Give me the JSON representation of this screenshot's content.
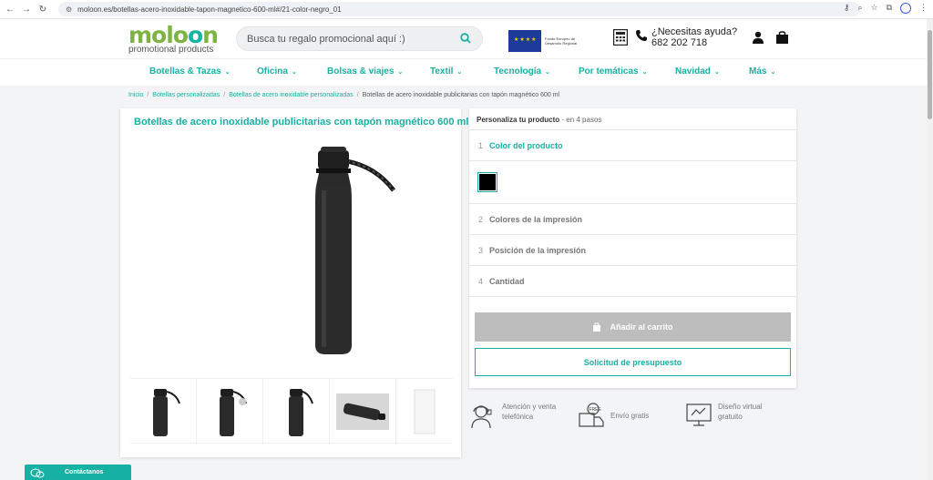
{
  "browser": {
    "url": "moloon.es/botellas-acero-inoxidable-tapon-magnetico-600-ml#/21-color-negro_01"
  },
  "header": {
    "logo_part1": "molo",
    "logo_oo": "o",
    "logo_part2": "n",
    "logo_tagline": "promotional products",
    "search_placeholder": "Busca tu regalo promocional aquí :)",
    "help_line1": "¿Necesitas ayuda?",
    "help_phone": "682 202 718"
  },
  "menu": {
    "items": [
      {
        "label": "Botellas & Tazas"
      },
      {
        "label": "Oficina"
      },
      {
        "label": "Bolsas & viajes"
      },
      {
        "label": "Textil"
      },
      {
        "label": "Tecnología"
      },
      {
        "label": "Por temáticas"
      },
      {
        "label": "Navidad"
      },
      {
        "label": "Más"
      }
    ]
  },
  "breadcrumb": {
    "items": [
      "Inicio",
      "Botellas personalizadas",
      "Botellas de acero inoxidable personalizadas",
      "Botellas de acero inoxidable publicitarias con tapón magnético 600 ml"
    ]
  },
  "product": {
    "title": "Botellas de acero inoxidable publicitarias con tapón magnético 600 ml"
  },
  "customizer": {
    "head_bold": "Personaliza tu producto",
    "head_sub": "- en 4 pasos",
    "steps": [
      {
        "num": "1",
        "label": "Color del producto"
      },
      {
        "num": "2",
        "label": "Colores de la impresión"
      },
      {
        "num": "3",
        "label": "Posición de la impresión"
      },
      {
        "num": "4",
        "label": "Cantidad"
      }
    ],
    "selected_color": "#000000",
    "add_to_cart": "Añadir al carrito",
    "quote": "Solicitud de presupuesto"
  },
  "features": [
    {
      "text": "Atención y venta telefónica",
      "icon": "support-agent-icon"
    },
    {
      "text": "Envío gratis",
      "icon": "free-shipping-icon"
    },
    {
      "text": "Diseño virtual gratuito",
      "icon": "virtual-design-icon"
    }
  ],
  "contact": {
    "label": "Contáctanos"
  },
  "colors": {
    "brand_teal": "#18b0a2",
    "brand_green": "#7cb342"
  }
}
